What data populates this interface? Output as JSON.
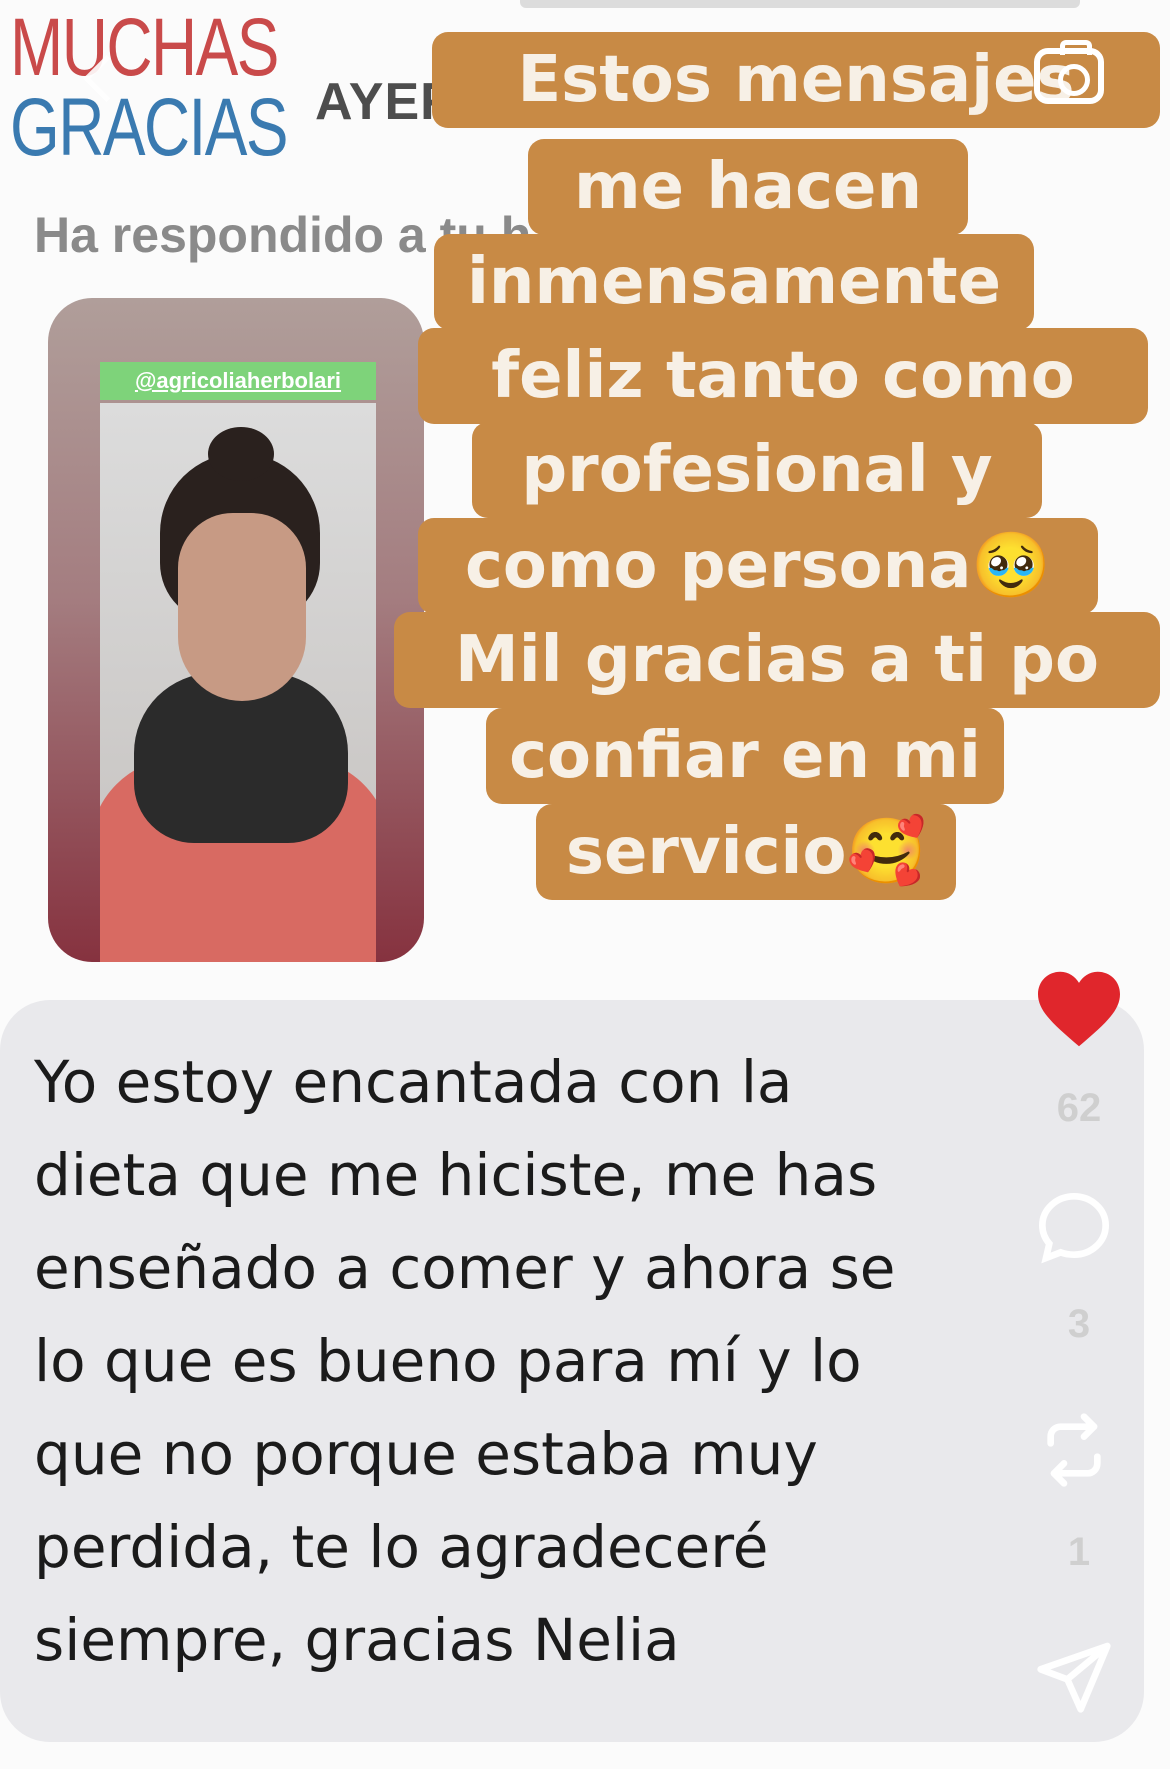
{
  "header": {
    "logo_line1": "MUCHAS",
    "logo_line2": "GRACIAS",
    "date": "AYER"
  },
  "reply_line": "Ha respondido a tu h",
  "story": {
    "tag": "@agricoliaherbolari",
    "reaction": "👍🏻"
  },
  "caption": {
    "lines": [
      "Estos mensajes",
      "me hacen",
      "inmensamente",
      "feliz tanto como",
      "profesional y",
      "como persona🥹",
      "Mil gracias a ti po",
      "confiar en mi",
      "servicio🥰"
    ]
  },
  "message": {
    "text": "Yo estoy encantada con la\ndieta que me hiciste, me has\nenseñado a comer y ahora se\nlo que es bueno para mí y lo\nque no porque estaba muy\nperdida, te lo agradeceré\nsiempre, gracias Nelia"
  },
  "actions": {
    "likes": "62",
    "comments": "3",
    "reposts": "1"
  },
  "colors": {
    "caption_bg": "#c88a45",
    "like_red": "#e0262c",
    "bubble_bg": "#e9e9ec"
  },
  "icons": [
    "back-chevron-icon",
    "camera-icon",
    "heart-icon",
    "comment-icon",
    "repost-icon",
    "send-icon"
  ]
}
